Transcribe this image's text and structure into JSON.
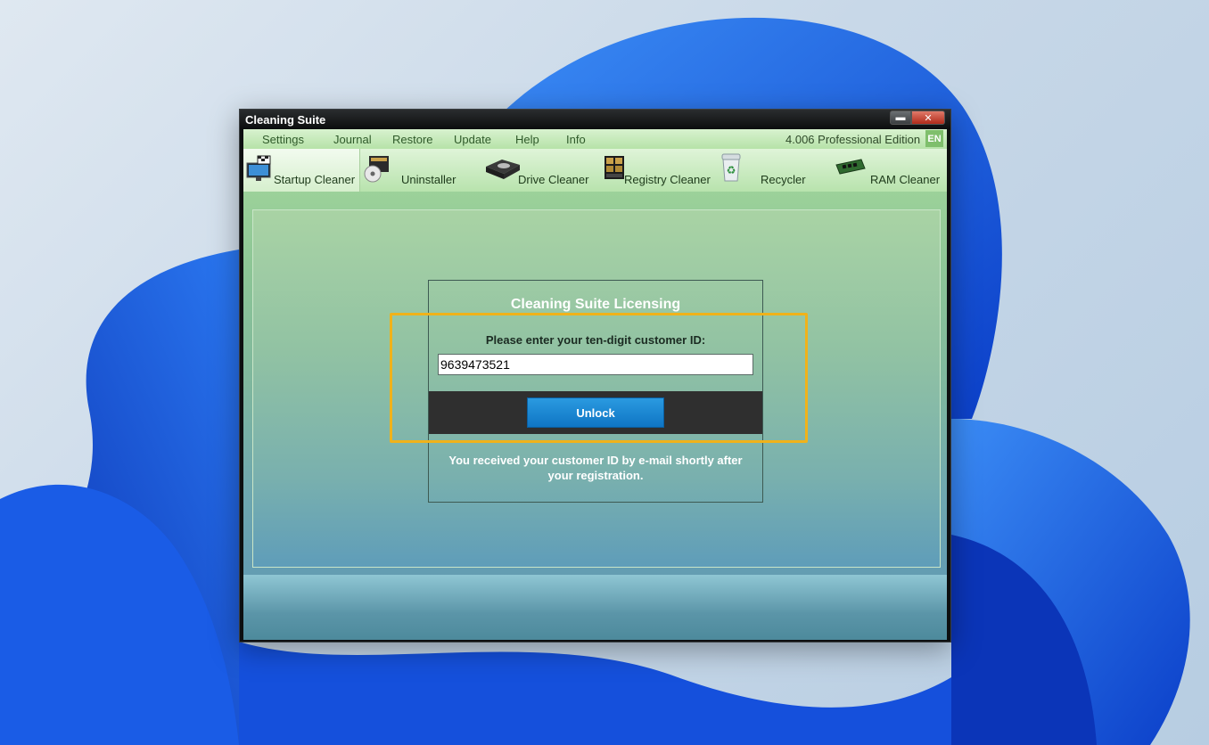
{
  "window": {
    "title": "Cleaning Suite"
  },
  "menu": {
    "items": [
      "Settings",
      "Journal",
      "Restore",
      "Update",
      "Help",
      "Info"
    ],
    "edition": "4.006 Professional Edition",
    "language": "EN"
  },
  "tabs": [
    {
      "label": "Startup Cleaner",
      "icon": "monitor-flag-icon"
    },
    {
      "label": "Uninstaller",
      "icon": "box-disc-icon"
    },
    {
      "label": "Drive Cleaner",
      "icon": "hard-drive-icon"
    },
    {
      "label": "Registry Cleaner",
      "icon": "registry-boxes-icon"
    },
    {
      "label": "Recycler",
      "icon": "recycle-bin-icon"
    },
    {
      "label": "RAM Cleaner",
      "icon": "ram-module-icon"
    }
  ],
  "license": {
    "title": "Cleaning Suite Licensing",
    "prompt": "Please enter your ten-digit customer ID:",
    "customer_id": "9639473521",
    "unlock_label": "Unlock",
    "help_line1": "You received your customer ID by e-mail shortly after",
    "help_line2": "your registration."
  },
  "colors": {
    "highlight": "#f0b21a",
    "unlock": "#1a85d1"
  }
}
